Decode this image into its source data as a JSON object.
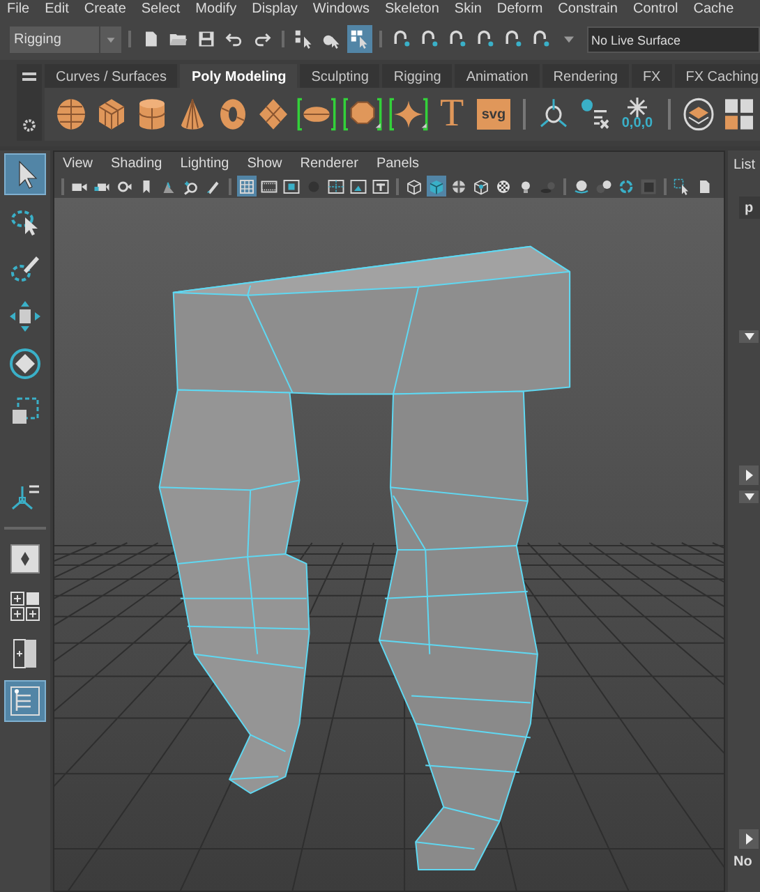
{
  "menu_bar": [
    "File",
    "Edit",
    "Create",
    "Select",
    "Modify",
    "Display",
    "Windows",
    "Skeleton",
    "Skin",
    "Deform",
    "Constrain",
    "Control",
    "Cache"
  ],
  "status_line": {
    "mode": "Rigging",
    "groups": [
      [
        {
          "kind": "page",
          "selected": false
        },
        {
          "kind": "folder",
          "selected": false
        },
        {
          "kind": "disk",
          "selected": false
        },
        {
          "kind": "undo",
          "selected": false
        },
        {
          "kind": "redo",
          "selected": false
        }
      ],
      [
        {
          "kind": "pick-hierarchy",
          "selected": false
        },
        {
          "kind": "pick-object",
          "selected": false
        },
        {
          "kind": "pick-component",
          "selected": true
        }
      ],
      [
        {
          "kind": "snap",
          "selected": false
        },
        {
          "kind": "snap",
          "selected": false
        },
        {
          "kind": "snap",
          "selected": false
        },
        {
          "kind": "snap",
          "selected": false
        },
        {
          "kind": "snap",
          "selected": false
        },
        {
          "kind": "snap",
          "selected": false
        },
        {
          "kind": "caret",
          "selected": false
        }
      ]
    ],
    "live_surface": "No Live Surface"
  },
  "shelf": {
    "tabs": [
      {
        "label": "Curves / Surfaces",
        "selected": false
      },
      {
        "label": "Poly Modeling",
        "selected": true
      },
      {
        "label": "Sculpting",
        "selected": false
      },
      {
        "label": "Rigging",
        "selected": false
      },
      {
        "label": "Animation",
        "selected": false
      },
      {
        "label": "Rendering",
        "selected": false
      },
      {
        "label": "FX",
        "selected": false
      },
      {
        "label": "FX Caching",
        "selected": false
      }
    ],
    "icons": [
      {
        "kind": "sphere"
      },
      {
        "kind": "cube"
      },
      {
        "kind": "cylinder"
      },
      {
        "kind": "cone"
      },
      {
        "kind": "torus"
      },
      {
        "kind": "plane"
      },
      {
        "kind": "bracket-disc"
      },
      {
        "kind": "bracket-poly"
      },
      {
        "kind": "bracket-star"
      },
      {
        "kind": "text",
        "label": "T"
      },
      {
        "kind": "svg",
        "label": "svg"
      },
      {
        "kind": "sep"
      },
      {
        "kind": "pivot"
      },
      {
        "kind": "history"
      },
      {
        "kind": "freeze",
        "label": "0,0,0"
      },
      {
        "kind": "sep"
      },
      {
        "kind": "layers"
      },
      {
        "kind": "tiles"
      }
    ]
  },
  "toolbox": [
    {
      "kind": "select",
      "selected": true
    },
    {
      "kind": "lasso",
      "selected": false
    },
    {
      "kind": "paint",
      "selected": false
    },
    {
      "kind": "move",
      "selected": false
    },
    {
      "kind": "rotate",
      "selected": false
    },
    {
      "kind": "scale",
      "selected": false
    },
    {
      "kind": "gap"
    },
    {
      "kind": "manipulator",
      "selected": false
    },
    {
      "kind": "rule"
    },
    {
      "kind": "layout-single",
      "selected": false
    },
    {
      "kind": "layout-four",
      "selected": false
    },
    {
      "kind": "layout-two",
      "selected": false
    },
    {
      "kind": "layout-outliner",
      "selected": true
    }
  ],
  "viewport": {
    "menu": [
      "View",
      "Shading",
      "Lighting",
      "Show",
      "Renderer",
      "Panels"
    ],
    "groups": [
      [
        {
          "kind": "camera",
          "selected": false
        },
        {
          "kind": "camera-lock",
          "selected": false
        },
        {
          "kind": "camera-attr",
          "selected": false
        },
        {
          "kind": "bookmark",
          "selected": false
        },
        {
          "kind": "image-plane",
          "selected": false
        },
        {
          "kind": "zoom",
          "selected": false
        },
        {
          "kind": "pencil",
          "selected": false
        }
      ],
      [
        {
          "kind": "grid",
          "selected": true
        },
        {
          "kind": "film",
          "selected": false
        },
        {
          "kind": "square",
          "selected": false
        },
        {
          "kind": "dark-circle",
          "selected": false
        },
        {
          "kind": "frame",
          "selected": false
        },
        {
          "kind": "picture",
          "selected": false
        },
        {
          "kind": "boxed",
          "selected": false
        }
      ],
      [
        {
          "kind": "wire-cube",
          "selected": false
        },
        {
          "kind": "shaded-cube",
          "selected": true
        },
        {
          "kind": "checker-sphere",
          "selected": false
        },
        {
          "kind": "wire-cube-teal",
          "selected": false
        },
        {
          "kind": "checker",
          "selected": false
        },
        {
          "kind": "bulb",
          "selected": false
        },
        {
          "kind": "shadow",
          "selected": false
        }
      ],
      [
        {
          "kind": "sphere-flat",
          "selected": false
        },
        {
          "kind": "spheres",
          "selected": false
        },
        {
          "kind": "ring",
          "selected": false
        },
        {
          "kind": "dark-square",
          "selected": false
        }
      ],
      [
        {
          "kind": "select-box",
          "selected": false
        },
        {
          "kind": "page",
          "selected": false
        }
      ]
    ]
  },
  "side_panel": {
    "title": "List",
    "tab": "p",
    "footer": "No"
  }
}
